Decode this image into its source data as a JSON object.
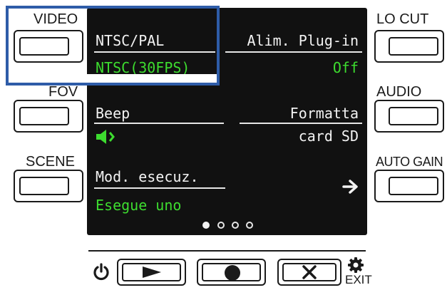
{
  "left_buttons": [
    {
      "label": "VIDEO"
    },
    {
      "label": "FOV"
    },
    {
      "label": "SCENE"
    }
  ],
  "right_buttons": [
    {
      "label": "LO CUT"
    },
    {
      "label": "AUDIO"
    },
    {
      "label": "AUTO GAIN"
    }
  ],
  "screen": {
    "items": [
      {
        "title": "NTSC/PAL",
        "value": "NTSC(30FPS)"
      },
      {
        "title": "Alim. Plug-in",
        "value": "Off"
      },
      {
        "title": "Beep",
        "value_icon": "speaker-on-icon"
      },
      {
        "title": "Formatta",
        "value": "card SD"
      },
      {
        "title": "Mod. esecuz.",
        "value": "Esegue uno"
      }
    ],
    "next_icon": "arrow-right-icon",
    "page_indicator": {
      "total": 4,
      "current": 1
    }
  },
  "controls": {
    "power_icon": "power-icon",
    "play_icon": "play-icon",
    "record_icon": "record-icon",
    "stop_icon": "x-icon",
    "settings_icon": "gear-icon",
    "exit_label": "EXIT"
  },
  "colors": {
    "highlight": "#2e5ca8",
    "screen_bg": "#111111",
    "value_green": "#3ddc2f"
  }
}
